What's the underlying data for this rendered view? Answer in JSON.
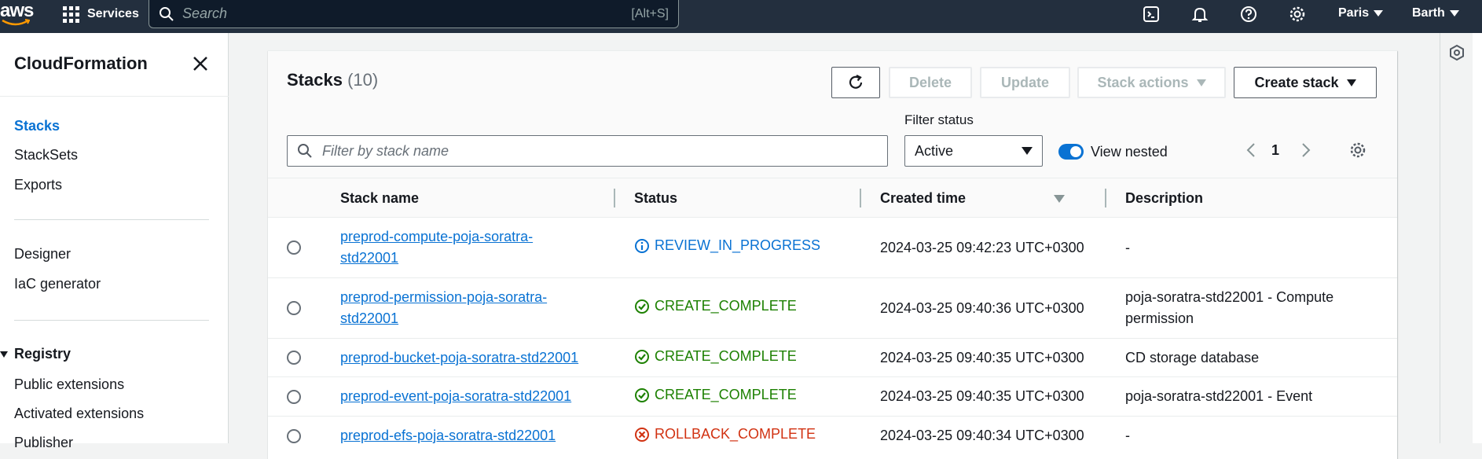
{
  "topnav": {
    "logo_text": "aws",
    "services_label": "Services",
    "search_placeholder": "Search",
    "search_hint": "[Alt+S]",
    "region": "Paris",
    "user": "Barth"
  },
  "sidebar": {
    "title": "CloudFormation",
    "items": [
      {
        "label": "Stacks",
        "active": true
      },
      {
        "label": "StackSets"
      },
      {
        "label": "Exports"
      }
    ],
    "tools": [
      {
        "label": "Designer"
      },
      {
        "label": "IaC generator"
      }
    ],
    "registry_label": "Registry",
    "registry_items": [
      {
        "label": "Public extensions"
      },
      {
        "label": "Activated extensions"
      },
      {
        "label": "Publisher"
      }
    ]
  },
  "panel": {
    "title": "Stacks",
    "count": "(10)",
    "buttons": {
      "delete": "Delete",
      "update": "Update",
      "stack_actions": "Stack actions",
      "create_stack": "Create stack"
    },
    "filter_placeholder": "Filter by stack name",
    "filter_status_label": "Filter status",
    "filter_status_value": "Active",
    "view_nested_label": "View nested",
    "page": "1"
  },
  "table": {
    "columns": [
      "Stack name",
      "Status",
      "Created time",
      "Description"
    ],
    "rows": [
      {
        "name_line1": "preprod-compute-poja-soratra-",
        "name_line2": "std22001",
        "status": "REVIEW_IN_PROGRESS",
        "kind": "info",
        "created": "2024-03-25 09:42:23 UTC+0300",
        "desc_line1": "-",
        "desc_line2": ""
      },
      {
        "name_line1": "preprod-permission-poja-soratra-",
        "name_line2": "std22001",
        "status": "CREATE_COMPLETE",
        "kind": "ok",
        "created": "2024-03-25 09:40:36 UTC+0300",
        "desc_line1": "poja-soratra-std22001 - Compute",
        "desc_line2": "permission"
      },
      {
        "name_line1": "preprod-bucket-poja-soratra-std22001",
        "name_line2": "",
        "status": "CREATE_COMPLETE",
        "kind": "ok",
        "created": "2024-03-25 09:40:35 UTC+0300",
        "desc_line1": "CD storage database",
        "desc_line2": ""
      },
      {
        "name_line1": "preprod-event-poja-soratra-std22001",
        "name_line2": "",
        "status": "CREATE_COMPLETE",
        "kind": "ok",
        "created": "2024-03-25 09:40:35 UTC+0300",
        "desc_line1": "poja-soratra-std22001 - Event",
        "desc_line2": ""
      },
      {
        "name_line1": "preprod-efs-poja-soratra-std22001",
        "name_line2": "",
        "status": "ROLLBACK_COMPLETE",
        "kind": "err",
        "created": "2024-03-25 09:40:34 UTC+0300",
        "desc_line1": "-",
        "desc_line2": ""
      }
    ]
  },
  "colors": {
    "nav_bg": "#232f3e",
    "link": "#0972d3",
    "success": "#1d8102",
    "error": "#d13212"
  }
}
